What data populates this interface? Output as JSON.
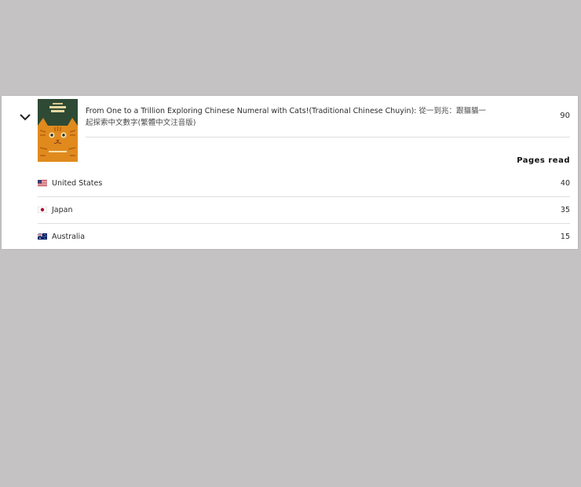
{
  "book": {
    "title_en": "From One to a Trillion Exploring Chinese Numeral with Cats!(Traditional Chinese Chuyin):",
    "title_zh_line1": "從一到兆：跟貓貓一",
    "title_zh_line2": "起探索中文數字(繁體中文注音版)",
    "total_pages": "90",
    "cover_colors": {
      "background": "#2e4a34",
      "cat": "#e08a1e",
      "stripes": "#b5600f"
    }
  },
  "table": {
    "column_header": "Pages read",
    "rows": [
      {
        "flag": "us-flag-icon",
        "country": "United States",
        "pages": "40"
      },
      {
        "flag": "japan-flag-icon",
        "country": "Japan",
        "pages": "35"
      },
      {
        "flag": "australia-flag-icon",
        "country": "Australia",
        "pages": "15"
      }
    ]
  }
}
